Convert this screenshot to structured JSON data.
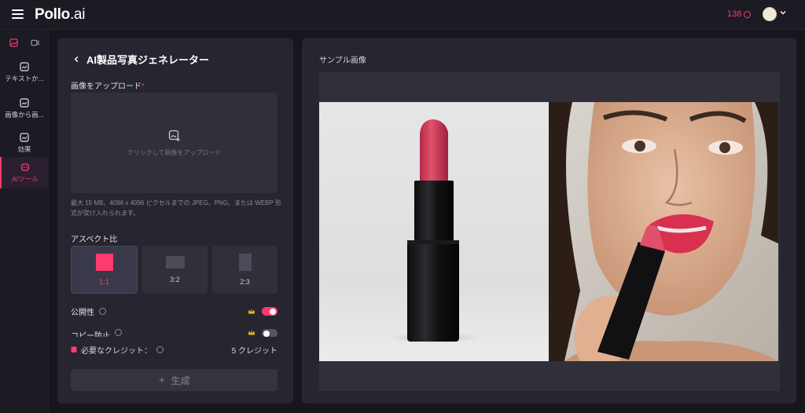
{
  "brand": {
    "name": "Pollo",
    "suffix": ".ai"
  },
  "header": {
    "credits": "138"
  },
  "sidebar": {
    "items": [
      {
        "label": "テキストか..."
      },
      {
        "label": "画像から画..."
      },
      {
        "label": "効果"
      },
      {
        "label": "AIツール",
        "active": true
      }
    ]
  },
  "form": {
    "title": "AI製品写真ジェネレーター",
    "upload_label": "画像をアップロード",
    "required_mark": "*",
    "upload_prompt": "クリックして画像をアップロード",
    "upload_hint": "最大 15 MB、4096 x 4096 ピクセルまでの JPEG、PNG、または WEBP 形式が受け入れられます。",
    "aspect_label": "アスペクト比",
    "aspects": [
      {
        "label": "1:1",
        "selected": true
      },
      {
        "label": "3:2",
        "selected": false
      },
      {
        "label": "2:3",
        "selected": false
      }
    ],
    "public_label": "公開性",
    "public_on": true,
    "copy_protect_label": "コピー防止",
    "copy_protect_on": false,
    "credits_label": "必要なクレジット：",
    "credits_value": "5 クレジット",
    "generate_label": "生成"
  },
  "sample": {
    "title": "サンプル画像"
  },
  "colors": {
    "accent": "#ff3a6e",
    "background": "#17161d",
    "panel": "#262530"
  }
}
